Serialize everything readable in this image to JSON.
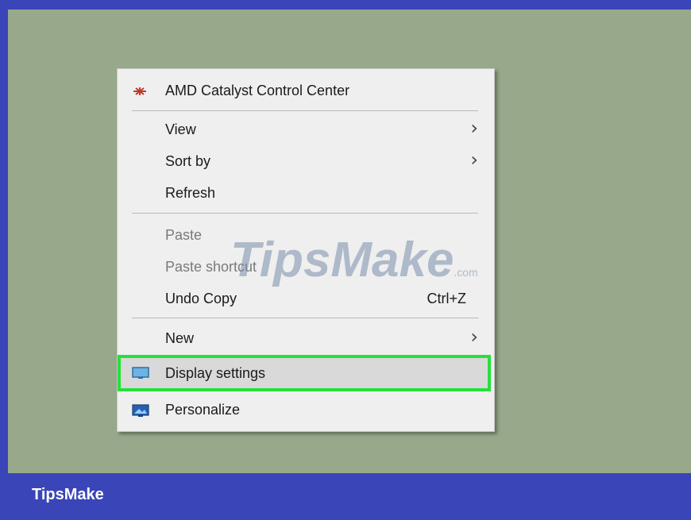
{
  "brand": "TipsMake",
  "watermark": {
    "main": "TipsMake",
    "suffix": ".com"
  },
  "menu": {
    "items": [
      {
        "label": "AMD Catalyst Control Center",
        "icon": "amd-icon"
      },
      {
        "label": "View",
        "submenu": true
      },
      {
        "label": "Sort by",
        "submenu": true
      },
      {
        "label": "Refresh"
      },
      {
        "label": "Paste",
        "disabled": true
      },
      {
        "label": "Paste shortcut",
        "disabled": true
      },
      {
        "label": "Undo Copy",
        "shortcut": "Ctrl+Z"
      },
      {
        "label": "New",
        "submenu": true
      },
      {
        "label": "Display settings",
        "icon": "display-icon",
        "highlighted": true
      },
      {
        "label": "Personalize",
        "icon": "personalize-icon"
      }
    ]
  },
  "colors": {
    "frame": "#3a45b8",
    "desktop": "#97a98a",
    "menu_bg": "#efefef",
    "highlight_border": "#26e03b"
  }
}
